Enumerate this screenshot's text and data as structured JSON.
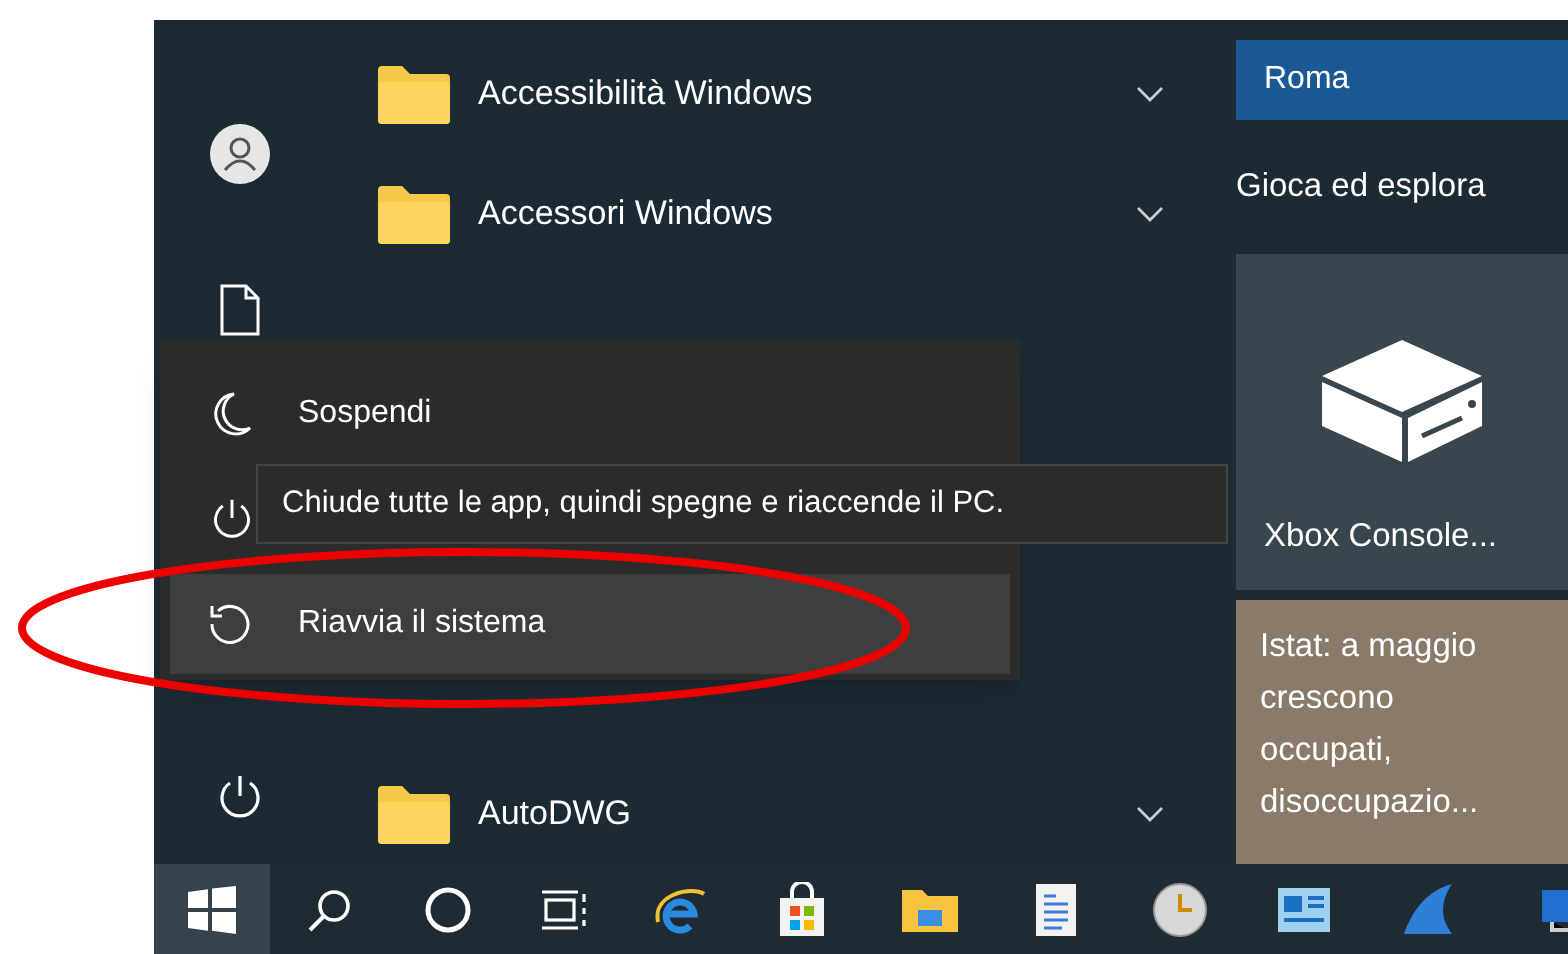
{
  "apps": [
    {
      "label": "Accessibilità Windows",
      "kind": "folder"
    },
    {
      "label": "Accessori Windows",
      "kind": "folder"
    },
    {
      "label": "AutoDWG",
      "kind": "folder"
    }
  ],
  "power_menu": {
    "items": [
      {
        "label": "Sospendi",
        "kind": "sleep",
        "selected": false
      },
      {
        "label": "Riavvia il sistema",
        "kind": "restart",
        "selected": true
      }
    ],
    "tooltip": "Chiude tutte le app, quindi spegne e riaccende il PC."
  },
  "tiles": {
    "group_1": "Roma",
    "group_2": "Gioca ed esplora",
    "xbox": "Xbox Console...",
    "news": "Istat: a maggio crescono occupati, disoccupazio..."
  }
}
